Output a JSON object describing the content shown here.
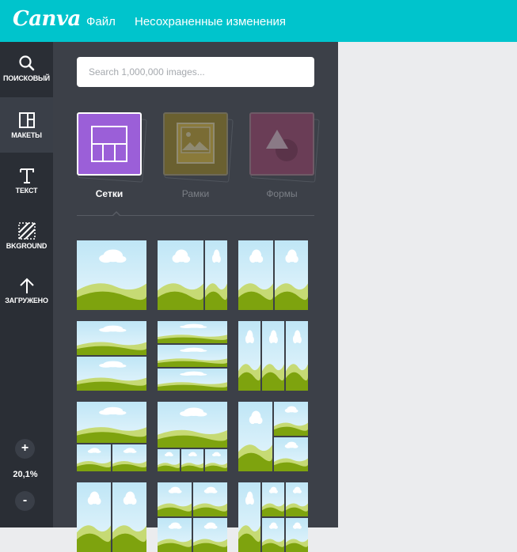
{
  "header": {
    "logo": "Canva",
    "file_menu": "Файл",
    "status": "Несохраненные изменения"
  },
  "sidebar": {
    "items": [
      {
        "label": "ПОИСКОВЫЙ",
        "icon": "search-icon"
      },
      {
        "label": "МАКЕТЫ",
        "icon": "layouts-icon"
      },
      {
        "label": "ТЕКСТ",
        "icon": "text-icon"
      },
      {
        "label": "BKGROUND",
        "icon": "background-icon"
      },
      {
        "label": "ЗАГРУЖЕНО",
        "icon": "upload-arrow-icon"
      }
    ],
    "zoom_in": "+",
    "zoom_level": "20,1%",
    "zoom_out": "-"
  },
  "panel": {
    "search_placeholder": "Search 1,000,000 images...",
    "categories": [
      {
        "label": "Сетки",
        "color": "#9b5fd8",
        "active": true
      },
      {
        "label": "Рамки",
        "color": "#6a6030",
        "active": false
      },
      {
        "label": "Формы",
        "color": "#6a3d56",
        "active": false
      }
    ],
    "grid_thumbnail_count": 12
  },
  "colors": {
    "brand": "#00c4cc",
    "rail": "#2a2e35",
    "panel": "#3c4048",
    "workspace": "#ebecee"
  }
}
